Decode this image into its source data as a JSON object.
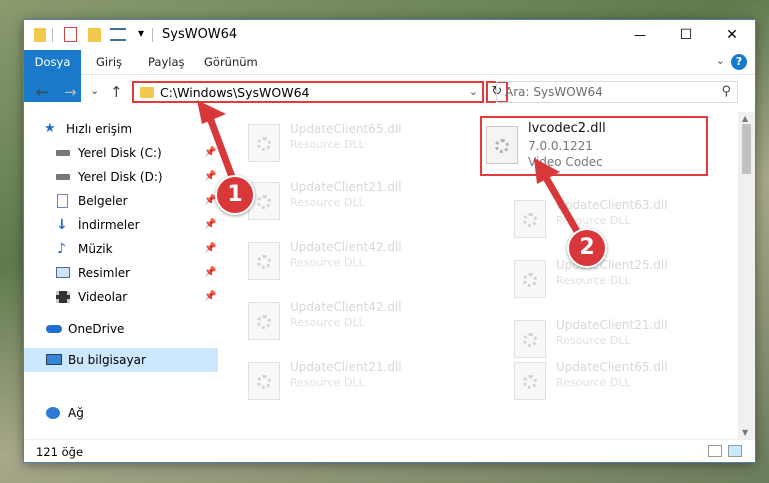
{
  "window": {
    "title": "SysWOW64",
    "qa_dropdown": "▾"
  },
  "controls": {
    "minimize": "—",
    "maximize": "☐",
    "close": "✕"
  },
  "ribbon": {
    "tabs": [
      "Dosya",
      "Giriş",
      "Paylaş",
      "Görünüm"
    ],
    "help": "?"
  },
  "nav": {
    "back": "←",
    "forward": "→",
    "recent": "⌄",
    "up": "↑",
    "address": "C:\\Windows\\SysWOW64",
    "address_chevron": "⌄",
    "refresh": "↻",
    "search_placeholder": "Ara: SysWOW64",
    "search_icon": "⚲"
  },
  "sidebar": {
    "items": [
      {
        "label": "Hızlı erişim",
        "icon": "star-icon",
        "pinned": false
      },
      {
        "label": "Yerel Disk (C:)",
        "icon": "drive-icon",
        "pinned": true
      },
      {
        "label": "Yerel Disk (D:)",
        "icon": "drive-icon",
        "pinned": true
      },
      {
        "label": "Belgeler",
        "icon": "documents-icon",
        "pinned": true
      },
      {
        "label": "İndirmeler",
        "icon": "download-icon",
        "pinned": true
      },
      {
        "label": "Müzik",
        "icon": "music-icon",
        "pinned": true
      },
      {
        "label": "Resimler",
        "icon": "pictures-icon",
        "pinned": true
      },
      {
        "label": "Videolar",
        "icon": "videos-icon",
        "pinned": true
      },
      {
        "label": "OneDrive",
        "icon": "cloud-icon",
        "pinned": false
      },
      {
        "label": "Bu bilgisayar",
        "icon": "computer-icon",
        "pinned": false,
        "selected": true
      },
      {
        "label": "Ağ",
        "icon": "network-icon",
        "pinned": false
      }
    ],
    "pin_glyph": "📌"
  },
  "files": {
    "left_column": [
      {
        "name": "UpdateClient65.dll",
        "type": "Resource DLL"
      },
      {
        "name": "UpdateClient21.dll",
        "type": "Resource DLL"
      },
      {
        "name": "UpdateClient42.dll",
        "type": "Resource DLL"
      },
      {
        "name": "UpdateClient42.dll",
        "type": "Resource DLL"
      },
      {
        "name": "UpdateClient21.dll",
        "type": "Resource DLL"
      }
    ],
    "right_column": [
      {
        "name": "UpdateClient63.dll",
        "type": "Resource DLL"
      },
      {
        "name": "UpdateClient25.dll",
        "type": "Resource DLL"
      },
      {
        "name": "UpdateClient21.dll",
        "type": "Resource DLL"
      },
      {
        "name": "UpdateClient65.dll",
        "type": "Resource DLL"
      }
    ],
    "highlighted": {
      "name": "lvcodec2.dll",
      "version": "7.0.0.1221",
      "description": "Video Codec"
    }
  },
  "status": {
    "count": "121 öğe"
  },
  "callouts": [
    "1",
    "2"
  ],
  "colors": {
    "accent": "#1979ca",
    "highlight": "#e33a3a",
    "selection": "#cce8ff"
  }
}
